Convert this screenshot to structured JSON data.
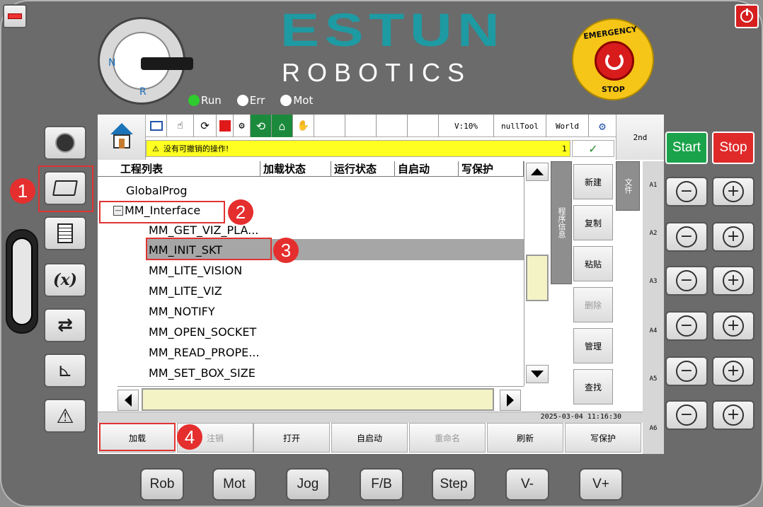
{
  "brand": {
    "logo": "ESTUN",
    "subtitle": "ROBOTICS"
  },
  "key_switch": {
    "n": "N",
    "r": "R"
  },
  "status_lights": [
    {
      "label": "Run",
      "color": "#2ecc2e"
    },
    {
      "label": "Err",
      "color": "#ffffff"
    },
    {
      "label": "Mot",
      "color": "#ffffff"
    }
  ],
  "emergency": {
    "top": "EMERGENCY",
    "bottom": "STOP"
  },
  "toolbar": {
    "speed": "V:10%",
    "tool": "nullTool",
    "frame": "World",
    "second": "2nd"
  },
  "message": {
    "icon": "⚠",
    "text": "没有可撤销的操作!",
    "count": "1",
    "check": "✓"
  },
  "table": {
    "headers": [
      "工程列表",
      "加载状态",
      "运行状态",
      "自启动",
      "写保护"
    ],
    "items": [
      {
        "label": "GlobalProg"
      },
      {
        "label": "MM_Interface",
        "expander": "—"
      },
      {
        "label": "MM_GET_VIZ_PLA..."
      },
      {
        "label": "MM_INIT_SKT"
      },
      {
        "label": "MM_LITE_VISION"
      },
      {
        "label": "MM_LITE_VIZ"
      },
      {
        "label": "MM_NOTIFY"
      },
      {
        "label": "MM_OPEN_SOCKET"
      },
      {
        "label": "MM_READ_PROPE..."
      },
      {
        "label": "MM_SET_BOX_SIZE"
      }
    ],
    "selected_index": 3
  },
  "side_tabs": {
    "info": "程序信息",
    "file": "文件"
  },
  "right_buttons": [
    "新建",
    "复制",
    "粘贴",
    "删除",
    "管理",
    "查找"
  ],
  "timestamp": "2025-03-04 11:16:30",
  "bottom_buttons": [
    "加载",
    "注销",
    "打开",
    "自启动",
    "重命名",
    "刷新",
    "写保护"
  ],
  "axes": [
    "A1",
    "A2",
    "A3",
    "A4",
    "A5",
    "A6"
  ],
  "start_stop": {
    "start": "Start",
    "stop": "Stop",
    "start_color": "#1aa34a",
    "stop_color": "#e02a2a"
  },
  "hw_buttons": [
    "Rob",
    "Mot",
    "Jog",
    "F/B",
    "Step",
    "V-",
    "V+"
  ],
  "annotations": [
    "1",
    "2",
    "3",
    "4"
  ],
  "left_icons": [
    "user-icon",
    "folder-open-icon",
    "document-icon",
    "variable-icon",
    "io-arrows-icon",
    "coordinate-icon",
    "warning-icon"
  ],
  "formula_label": "(x)"
}
